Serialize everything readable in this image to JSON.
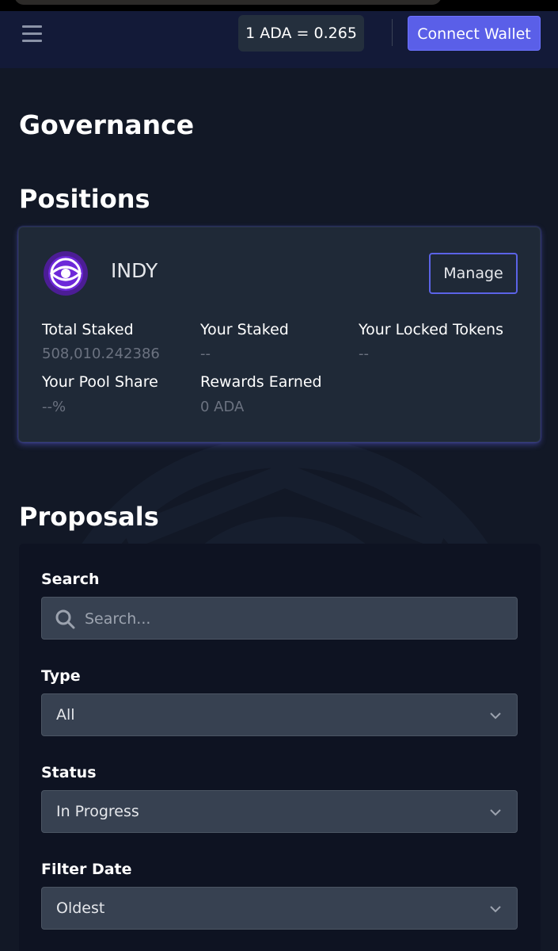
{
  "header": {
    "price_label": "1 ADA = 0.265",
    "connect_label": "Connect Wallet"
  },
  "page": {
    "title": "Governance"
  },
  "positions": {
    "heading": "Positions",
    "token": {
      "name": "INDY",
      "manage_label": "Manage",
      "stats": [
        {
          "label": "Total Staked",
          "value": "508,010.242386"
        },
        {
          "label": "Your Staked",
          "value": "--"
        },
        {
          "label": "Your Locked Tokens",
          "value": "--"
        },
        {
          "label": "Your Pool Share",
          "value": "--%"
        },
        {
          "label": "Rewards Earned",
          "value": "0 ADA"
        }
      ]
    }
  },
  "proposals": {
    "heading": "Proposals",
    "search": {
      "label": "Search",
      "placeholder": "Search..."
    },
    "type": {
      "label": "Type",
      "value": "All"
    },
    "status": {
      "label": "Status",
      "value": "In Progress"
    },
    "filter_date": {
      "label": "Filter Date",
      "value": "Oldest"
    }
  },
  "colors": {
    "accent": "#5a5fe8",
    "background": "#121826",
    "card": "#1f2937",
    "input": "#374151"
  },
  "icons": {
    "menu": "menu-icon",
    "logo": "indy-eye-icon",
    "search": "search-icon",
    "chevron": "chevron-down-icon"
  }
}
